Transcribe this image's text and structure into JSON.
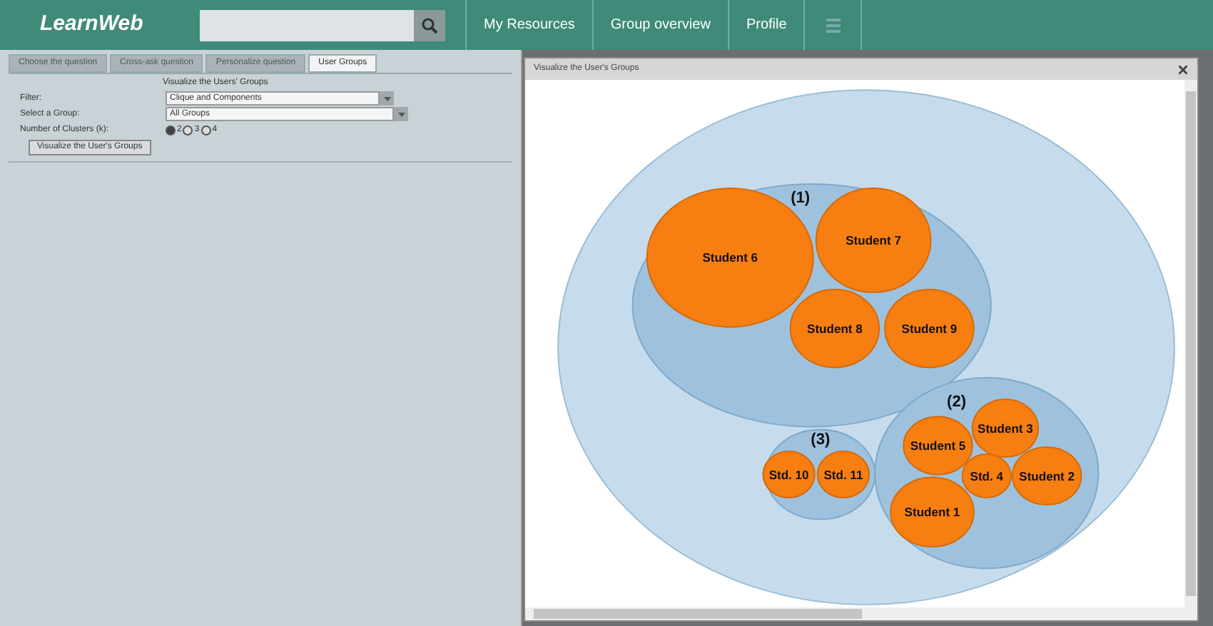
{
  "header": {
    "logo": "LearnWeb",
    "nav": [
      "My Resources",
      "Group overview",
      "Profile"
    ]
  },
  "tabs": [
    {
      "label": "Choose the question",
      "selected": false
    },
    {
      "label": "Cross-ask question",
      "selected": false
    },
    {
      "label": "Personalize question",
      "selected": false
    },
    {
      "label": "User Groups",
      "selected": true
    }
  ],
  "form": {
    "heading": "Visualize the Users' Groups",
    "fields": [
      {
        "label": "Filter:",
        "value": "Clique and Components"
      },
      {
        "label": "Select a Group:",
        "value": "All Groups"
      }
    ],
    "clusters_label": "Number of Clusters (k):",
    "radios": [
      {
        "label": "2",
        "selected": true
      },
      {
        "label": "3",
        "selected": false
      },
      {
        "label": "4",
        "selected": false
      }
    ],
    "button": "Visualize the User's Groups"
  },
  "dialog": {
    "title": "Visualize the User's Groups",
    "clusters": [
      {
        "label": "(1)",
        "members": [
          "Student 6",
          "Student 7",
          "Student 8",
          "Student 9"
        ]
      },
      {
        "label": "(3)",
        "members": [
          "Std. 10",
          "Std. 11"
        ]
      },
      {
        "label": "(2)",
        "members": [
          "Student 3",
          "Student 5",
          "Std. 4",
          "Student 2",
          "Student 1"
        ]
      }
    ]
  }
}
